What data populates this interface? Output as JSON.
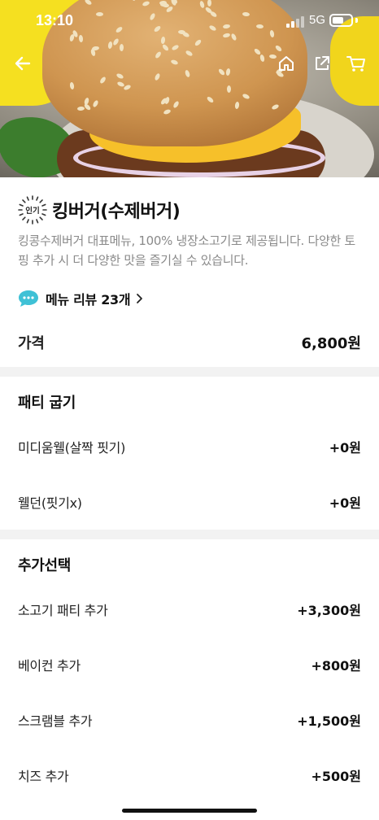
{
  "status_bar": {
    "time": "13:10",
    "network": "5G",
    "battery_level": 0.6
  },
  "header": {
    "icons": [
      "back-arrow-icon",
      "home-icon",
      "share-icon",
      "cart-icon"
    ]
  },
  "menu": {
    "badge": "인기",
    "title": "킹버거(수제버거)",
    "description": "킹콩수제버거 대표메뉴, 100% 냉장소고기로 제공됩니다. 다양한 토핑 추가 시 더 다양한 맛을 즐기실 수 있습니다.",
    "review_link": "메뉴 리뷰 23개"
  },
  "price": {
    "label": "가격",
    "value": "6,800원"
  },
  "patty_section": {
    "title": "패티 굽기",
    "options": [
      {
        "label": "미디움웰(살짝 핏기)",
        "price": "+0원"
      },
      {
        "label": "웰던(핏기x)",
        "price": "+0원"
      }
    ]
  },
  "extra_section": {
    "title": "추가선택",
    "options": [
      {
        "label": "소고기 패티 추가",
        "price": "+3,300원"
      },
      {
        "label": "베이컨 추가",
        "price": "+800원"
      },
      {
        "label": "스크램블 추가",
        "price": "+1,500원"
      },
      {
        "label": "치즈 추가",
        "price": "+500원"
      }
    ]
  }
}
